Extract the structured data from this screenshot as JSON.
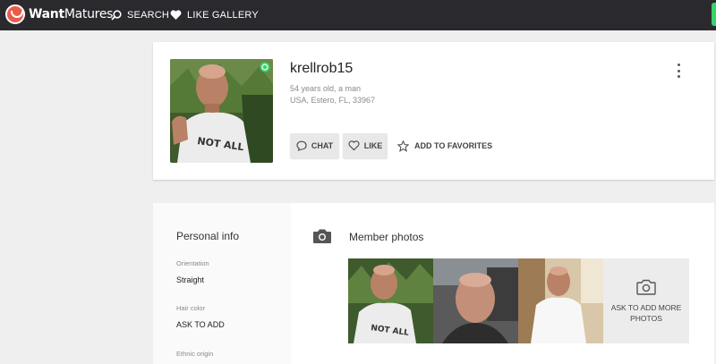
{
  "header": {
    "logo_text_bold": "Want",
    "logo_text_rest": "Matures",
    "nav": [
      {
        "label": "SEARCH",
        "icon": "search-icon"
      },
      {
        "label": "LIKE GALLERY",
        "icon": "heart-icon"
      }
    ]
  },
  "profile": {
    "username": "krellrob15",
    "age_gender": "54 years old, a man",
    "location": "USA, Estero, FL, 33967",
    "online_icon": "online-status-icon",
    "actions": {
      "chat": "CHAT",
      "like": "LIKE",
      "favorite": "ADD TO FAVORITES"
    }
  },
  "personal_info": {
    "title": "Personal info",
    "fields": [
      {
        "label": "Orientation",
        "value": "Straight"
      },
      {
        "label": "Hair color",
        "value": "ASK TO ADD"
      },
      {
        "label": "Ethnic origin",
        "value": ""
      }
    ]
  },
  "member_photos": {
    "title": "Member photos",
    "ask_more": "ASK TO ADD MORE PHOTOS",
    "photo_count_shown": 3
  },
  "colors": {
    "topbar": "#2a2a2e",
    "accent": "#e85d4a",
    "online": "#39d16a",
    "page_bg": "#efefef"
  }
}
